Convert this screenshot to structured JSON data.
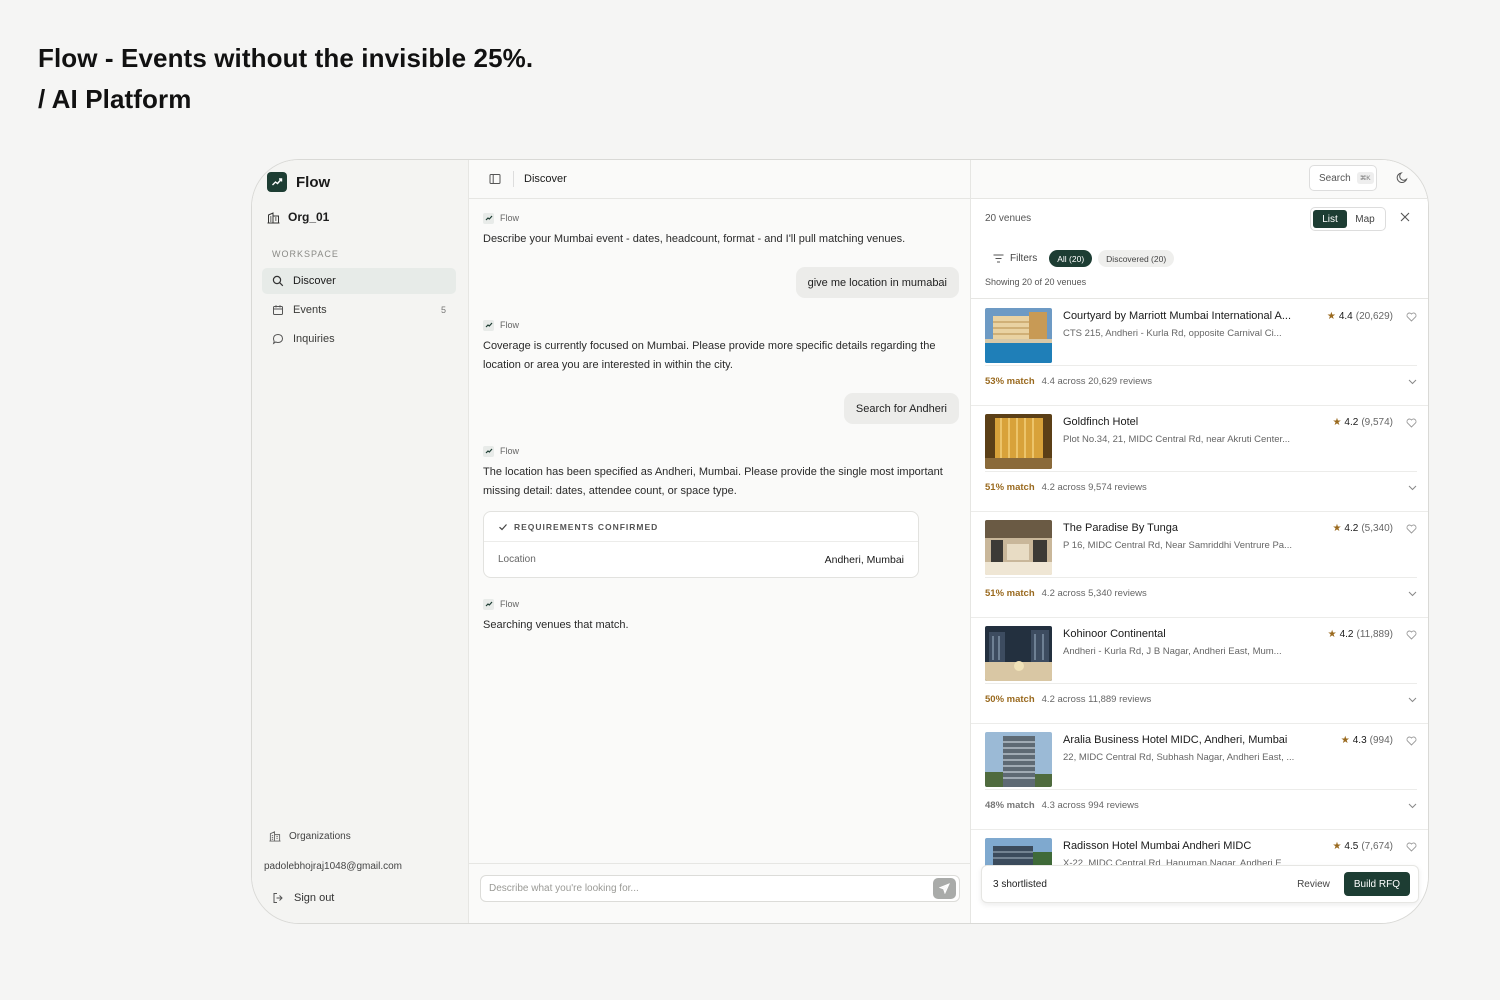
{
  "page": {
    "heading_line1": "Flow - Events without the invisible 25%.",
    "heading_line2": "/ AI Platform"
  },
  "sidebar": {
    "brand": "Flow",
    "org": "Org_01",
    "section_label": "WORKSPACE",
    "items": [
      {
        "label": "Discover",
        "icon": "search-icon",
        "active": true
      },
      {
        "label": "Events",
        "icon": "calendar-icon",
        "count": "5"
      },
      {
        "label": "Inquiries",
        "icon": "chat-bubble-icon"
      }
    ],
    "organizations_label": "Organizations",
    "email": "padolebhojraj1048@gmail.com",
    "sign_out": "Sign out"
  },
  "chat": {
    "title": "Discover",
    "sender": "Flow",
    "messages": [
      {
        "from": "bot",
        "text": "Describe your Mumbai event - dates, headcount, format - and I'll pull matching venues."
      },
      {
        "from": "user",
        "text": "give me location in mumabai"
      },
      {
        "from": "bot",
        "text": "Coverage is currently focused on Mumbai. Please provide more specific details regarding the location or area you are interested in within the city."
      },
      {
        "from": "user",
        "text": "Search for Andheri"
      },
      {
        "from": "bot",
        "text": "The location has been specified as Andheri, Mumbai. Please provide the single most important missing detail: dates, attendee count, or space type."
      },
      {
        "from": "bot",
        "text": "Searching venues that match."
      }
    ],
    "requirements": {
      "title": "REQUIREMENTS CONFIRMED",
      "rows": [
        {
          "key": "Location",
          "value": "Andheri, Mumbai"
        }
      ]
    },
    "composer_placeholder": "Describe what you're looking for..."
  },
  "results": {
    "search_label": "Search",
    "search_shortcut": "⌘K",
    "venue_count": "20 venues",
    "view_list": "List",
    "view_map": "Map",
    "filters_label": "Filters",
    "chip_all": "All (20)",
    "chip_discovered": "Discovered (20)",
    "showing": "Showing 20 of 20 venues",
    "accent": "#1d3d33",
    "match_color": "#9a6a1f",
    "venues": [
      {
        "name": "Courtyard by Marriott Mumbai International A...",
        "address": "CTS 215, Andheri - Kurla Rd, opposite Carnival Ci...",
        "rating": "4.4",
        "reviews": "(20,629)",
        "match": "53% match",
        "across": "4.4 across 20,629 reviews"
      },
      {
        "name": "Goldfinch Hotel",
        "address": "Plot No.34, 21, MIDC Central Rd, near Akruti Center...",
        "rating": "4.2",
        "reviews": "(9,574)",
        "match": "51% match",
        "across": "4.2 across 9,574 reviews"
      },
      {
        "name": "The Paradise By Tunga",
        "address": "P 16, MIDC Central Rd, Near Samriddhi Ventrure Pa...",
        "rating": "4.2",
        "reviews": "(5,340)",
        "match": "51% match",
        "across": "4.2 across 5,340 reviews"
      },
      {
        "name": "Kohinoor Continental",
        "address": "Andheri - Kurla Rd, J B Nagar, Andheri East, Mum...",
        "rating": "4.2",
        "reviews": "(11,889)",
        "match": "50% match",
        "across": "4.2 across 11,889 reviews"
      },
      {
        "name": "Aralia Business Hotel MIDC, Andheri, Mumbai",
        "address": "22, MIDC Central Rd, Subhash Nagar, Andheri East, ...",
        "rating": "4.3",
        "reviews": "(994)",
        "match": "48% match",
        "across": "4.3 across 994 reviews"
      },
      {
        "name": "Radisson Hotel Mumbai Andheri MIDC",
        "address": "X-22, MIDC Central Rd, Hanuman Nagar, Andheri E...",
        "rating": "4.5",
        "reviews": "(7,674)",
        "match": "",
        "across": ""
      }
    ],
    "shortlisted": "3 shortlisted",
    "review_label": "Review",
    "rfq_label": "Build RFQ"
  }
}
